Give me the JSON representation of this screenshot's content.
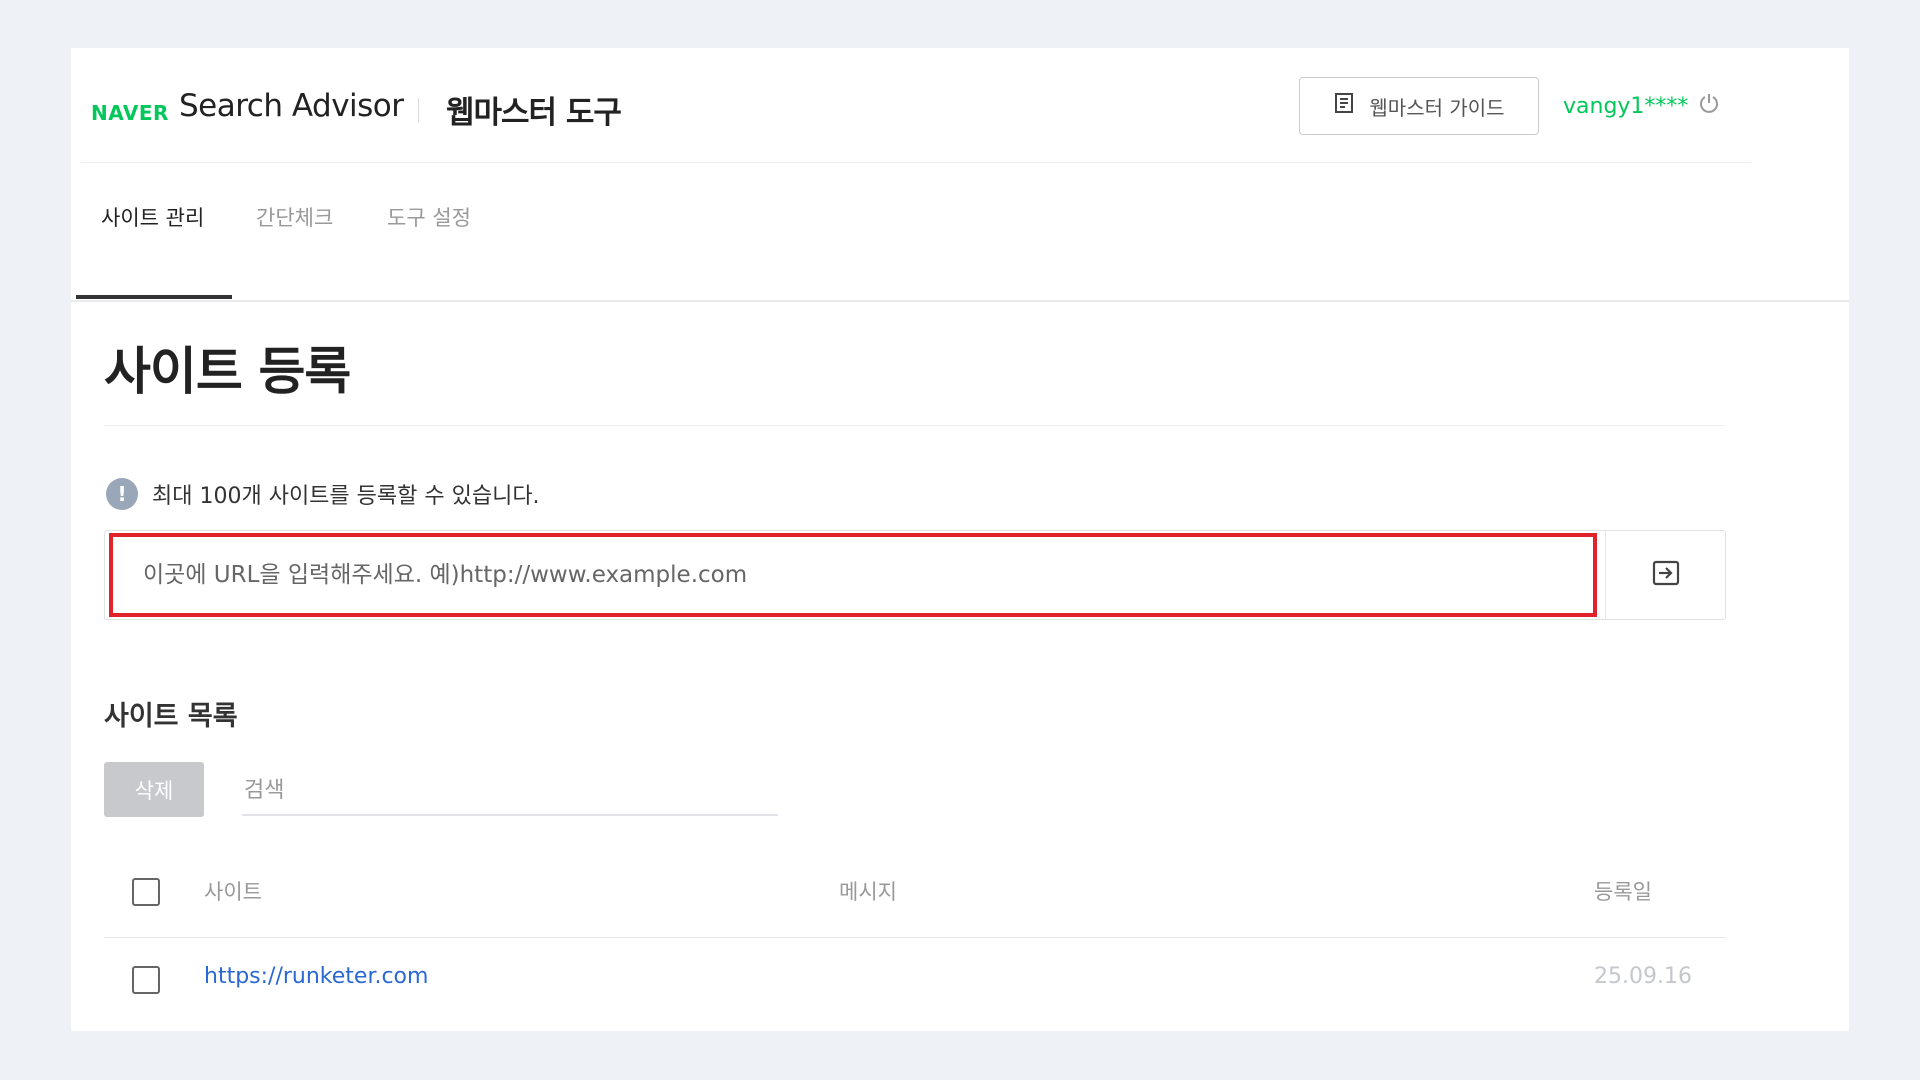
{
  "header": {
    "brand": "NAVER",
    "product": "Search Advisor",
    "section": "웹마스터 도구",
    "guide_button": "웹마스터 가이드",
    "username": "vangy1****"
  },
  "tabs": [
    {
      "label": "사이트 관리",
      "active": true
    },
    {
      "label": "간단체크",
      "active": false
    },
    {
      "label": "도구 설정",
      "active": false
    }
  ],
  "main": {
    "title": "사이트 등록",
    "notice": "최대 100개 사이트를 등록할 수 있습니다.",
    "url_input": {
      "placeholder": "이곳에 URL을 입력해주세요. 예)http://www.example.com",
      "value": ""
    }
  },
  "site_list": {
    "title": "사이트 목록",
    "delete_button": "삭제",
    "search_placeholder": "검색",
    "columns": [
      "사이트",
      "메시지",
      "등록일"
    ],
    "rows": [
      {
        "site": "https://runketer.com",
        "message": "",
        "date": "25.09.16"
      }
    ]
  },
  "colors": {
    "brand_green": "#03c75a",
    "highlight_red": "#e0232b",
    "link_blue": "#2a68d3"
  }
}
